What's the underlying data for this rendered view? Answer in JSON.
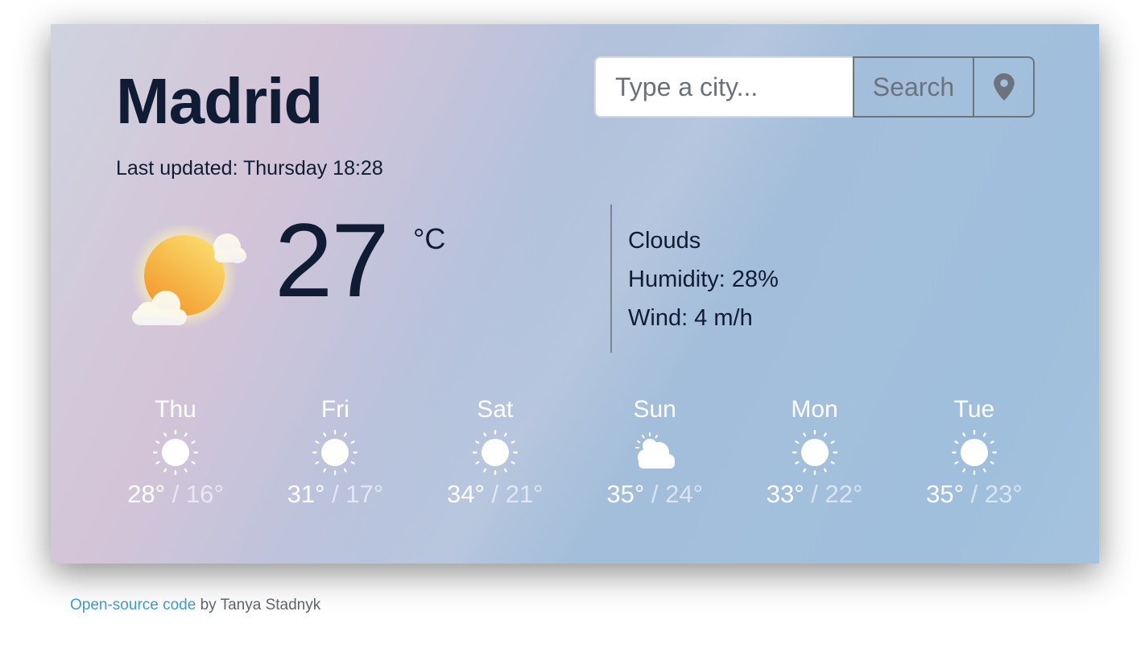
{
  "city": "Madrid",
  "last_updated": "Last updated: Thursday 18:28",
  "search": {
    "placeholder": "Type a city...",
    "value": "",
    "button_label": "Search",
    "location_icon": "map-pin-icon"
  },
  "current": {
    "icon": "sun-behind-clouds-icon",
    "temperature": "27",
    "unit": "°C",
    "condition": "Clouds",
    "humidity": "Humidity: 28%",
    "wind": "Wind: 4 m/h"
  },
  "forecast": [
    {
      "day": "Thu",
      "icon": "sun-icon",
      "max": "28°",
      "min": "16°"
    },
    {
      "day": "Fri",
      "icon": "sun-icon",
      "max": "31°",
      "min": "17°"
    },
    {
      "day": "Sat",
      "icon": "sun-icon",
      "max": "34°",
      "min": "21°"
    },
    {
      "day": "Sun",
      "icon": "partly-cloudy-icon",
      "max": "35°",
      "min": "24°"
    },
    {
      "day": "Mon",
      "icon": "sun-icon",
      "max": "33°",
      "min": "22°"
    },
    {
      "day": "Tue",
      "icon": "sun-icon",
      "max": "35°",
      "min": "23°"
    }
  ],
  "temp_separator": " / ",
  "footer": {
    "link_text": "Open-source code",
    "byline": " by Tanya Stadnyk"
  },
  "colors": {
    "text_dark": "#101c34",
    "link": "#3d9ad4",
    "button_border": "#6c737b"
  }
}
